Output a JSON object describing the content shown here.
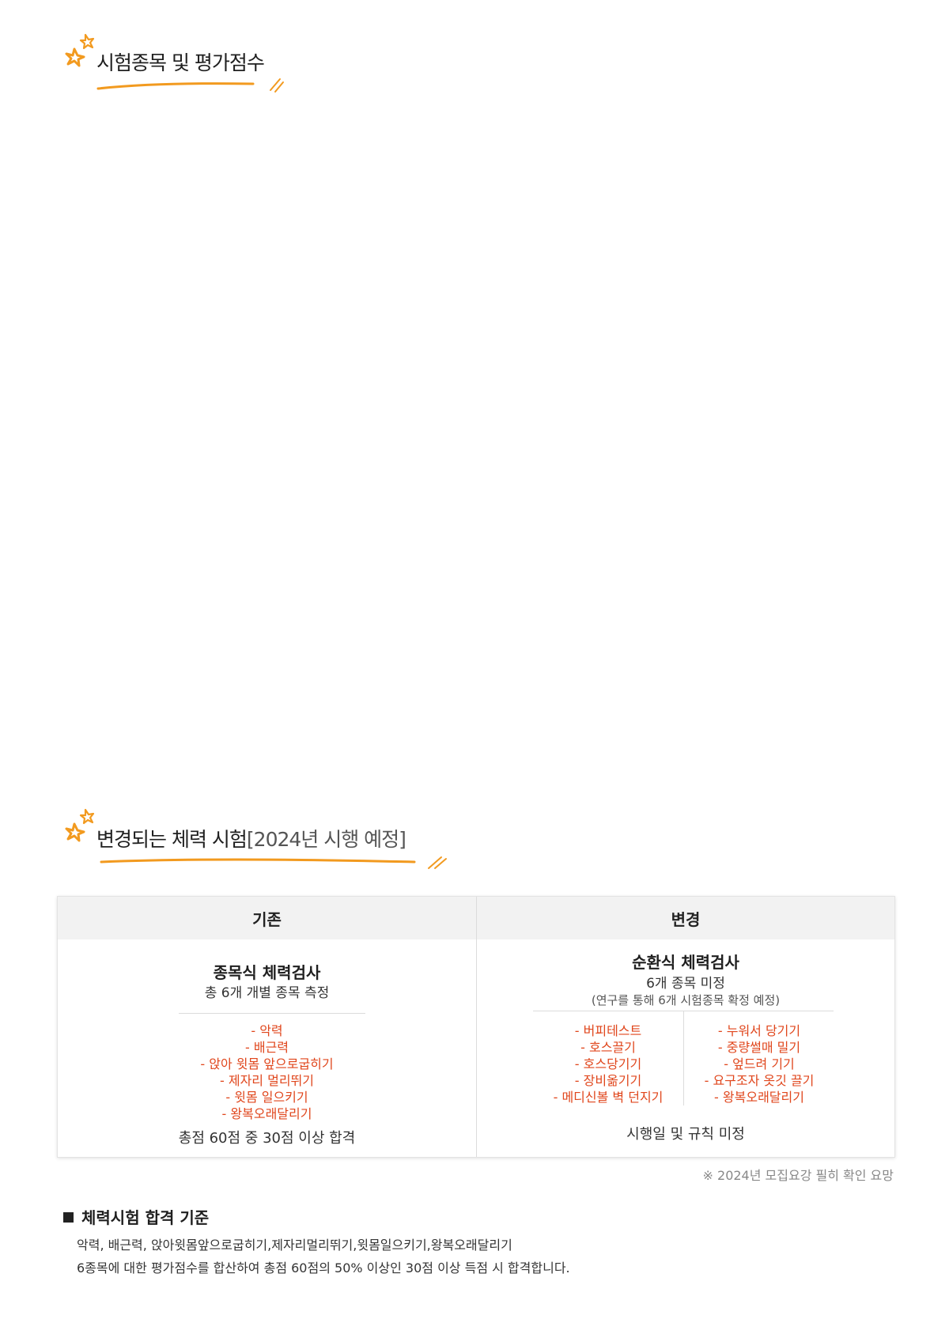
{
  "section1": {
    "title": "시험종목 및 평가점수"
  },
  "section2": {
    "title": "변경되는 체력 시험",
    "title_suffix": "[2024년 시행 예정]"
  },
  "table": {
    "headers": [
      "기존",
      "변경"
    ],
    "existing": {
      "name": "종목식 체력검사",
      "sub": "총 6개 개별 종목 측정",
      "items": [
        "악력",
        "배근력",
        "앉아 윗몸 앞으로굽히기",
        "제자리 멀리뛰기",
        "윗몸 일으키기",
        "왕복오래달리기"
      ],
      "pass": "총점 60점 중 30점 이상 합격"
    },
    "changed": {
      "name": "순환식 체력검사",
      "sub": "6개 종목 미정",
      "note": "(연구를 통해 6개 시험종목 확정 예정)",
      "items_left": [
        "버피테스트",
        "호스끌기",
        "호스당기기",
        "장비옮기기",
        "메디신볼 벽 던지기"
      ],
      "items_right": [
        "누워서 당기기",
        "중량썰매 밀기",
        "엎드려 기기",
        "요구조자 옷깃 끌기",
        "왕복오래달리기"
      ],
      "pass": "시행일 및 규칙 미정"
    }
  },
  "footnote": "※ 2024년 모집요강 필히 확인 요망",
  "criteria": {
    "title": "체력시험 합격 기준",
    "line1": "악력, 배근력, 앉아윗몸앞으로굽히기,제자리멀리뛰기,윗몸일으키기,왕복오래달리기",
    "line2": "6종목에 대한 평가점수를 합산하여 총점 60점의 50% 이상인 30점 이상 득점 시 합격합니다."
  },
  "colors": {
    "accent": "#f29a1f",
    "item_red": "#e0461c"
  }
}
